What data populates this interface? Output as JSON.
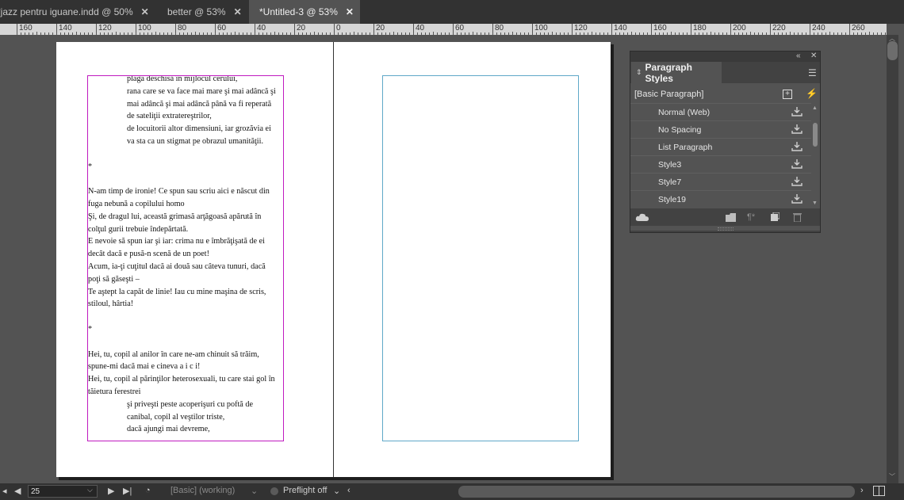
{
  "tabs": [
    {
      "label": "*jazz pentru iguane.indd @ 50%",
      "active": false
    },
    {
      "label": "better @ 53%",
      "active": false
    },
    {
      "label": "*Untitled-3 @ 53%",
      "active": true
    }
  ],
  "ruler": {
    "labels_left": [
      "160",
      "140",
      "120",
      "100",
      "80",
      "60",
      "40",
      "20"
    ],
    "label_zero": "0",
    "labels_right": [
      "20",
      "40",
      "60",
      "80",
      "100",
      "120",
      "140",
      "160",
      "180",
      "200",
      "220",
      "240",
      "260"
    ]
  },
  "document": {
    "left_text_lines": [
      {
        "text": "plaga deschisă în mijlocul cerului,",
        "indent": true
      },
      {
        "text": "rana care se va face mai mare şi mai adâncă şi",
        "indent": true
      },
      {
        "text": "mai adâncă şi mai adâncă până va fi reperată",
        "indent": true
      },
      {
        "text": "de sateliţii extratereştrilor,",
        "indent": true
      },
      {
        "text": "de locuitorii altor dimensiuni, iar grozăvia ei",
        "indent": true
      },
      {
        "text": "va sta ca un stigmat pe obrazul umanităţii.",
        "indent": true
      },
      {
        "text": "",
        "indent": false
      },
      {
        "text": "*",
        "indent": false
      },
      {
        "text": "",
        "indent": false
      },
      {
        "text": "N-am timp de ironie! Ce spun sau scriu aici e născut din",
        "indent": false
      },
      {
        "text": "fuga nebună a copilului homo",
        "indent": false
      },
      {
        "text": "Şi, de dragul lui, această grimasă arţăgoasă apărută în",
        "indent": false
      },
      {
        "text": "colţul gurii trebuie îndepărtată.",
        "indent": false
      },
      {
        "text": "E nevoie să spun iar şi iar: crima nu e îmbrăţişată de ei",
        "indent": false
      },
      {
        "text": "decât dacă e pusă-n scenă de un poet!",
        "indent": false
      },
      {
        "text": "Acum, ia-ţi cuţitul dacă ai două sau câteva tunuri, dacă",
        "indent": false
      },
      {
        "text": "poţi să găseşti –",
        "indent": false
      },
      {
        "text": "Te aştept la capăt de linie! Iau cu mine maşina de scris,",
        "indent": false
      },
      {
        "text": "stiloul, hârtia!",
        "indent": false
      },
      {
        "text": "",
        "indent": false
      },
      {
        "text": "*",
        "indent": false
      },
      {
        "text": "",
        "indent": false
      },
      {
        "text": "Hei, tu, copil al anilor în care ne-am chinuit să trăim,",
        "indent": false
      },
      {
        "text": "spune-mi dacă mai e cineva a i c i!",
        "indent": false
      },
      {
        "text": "Hei, tu, copil al părinţilor heterosexuali, tu care stai gol în",
        "indent": false
      },
      {
        "text": "tăietura ferestrei",
        "indent": false
      },
      {
        "text": "şi priveşti peste acoperişuri cu poftă de",
        "indent": true
      },
      {
        "text": "canibal, copil al veştilor triste,",
        "indent": true
      },
      {
        "text": "dacă ajungi mai devreme,",
        "indent": true
      }
    ]
  },
  "panel": {
    "title": "Paragraph Styles",
    "basic_style": "[Basic Paragraph]",
    "styles": [
      "Normal (Web)",
      "No Spacing",
      "List Paragraph",
      "Style3",
      "Style7",
      "Style19"
    ],
    "icons": {
      "collapse": "double-chevron-left-icon",
      "close": "close-icon",
      "menu": "hamburger-menu-icon",
      "new_style": "plus-box-icon",
      "quick_apply": "lightning-icon",
      "load": "cloud-icon",
      "folder": "folder-icon",
      "clear_overrides": "pilcrow-icon",
      "new": "new-page-icon",
      "delete": "trash-icon"
    }
  },
  "status": {
    "page_number": "25",
    "style_status": "[Basic] (working)",
    "preflight": "Preflight off"
  }
}
